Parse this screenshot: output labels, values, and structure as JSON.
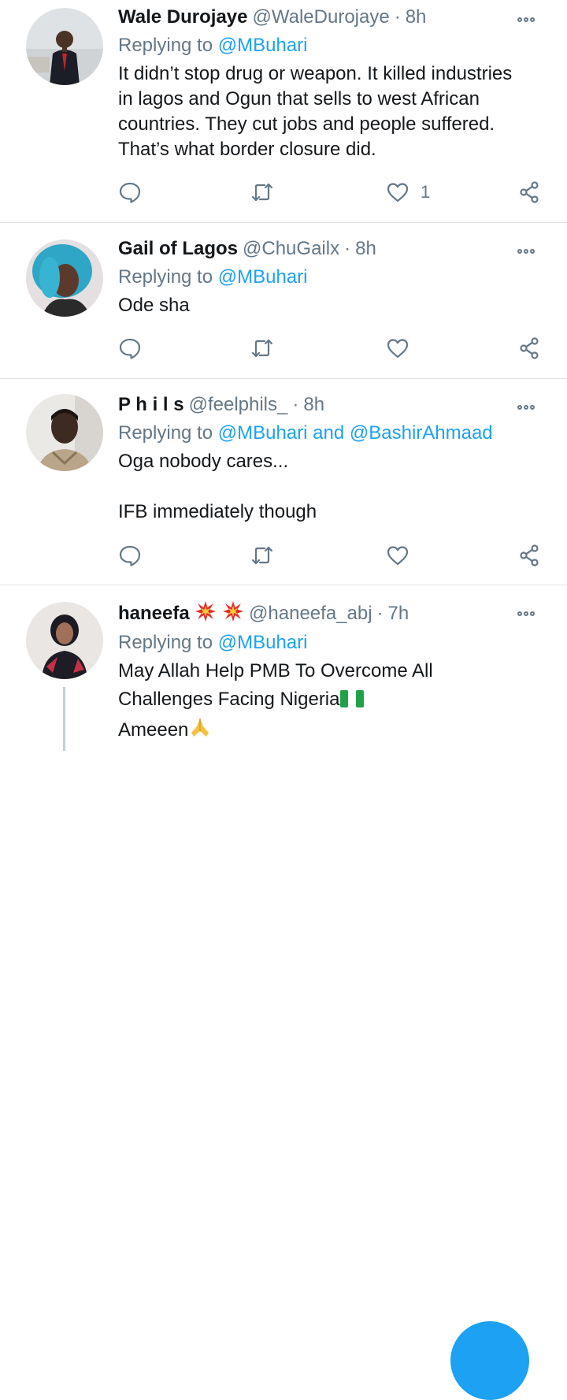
{
  "tweets": [
    {
      "name": "Wale Durojaye",
      "handle": "@WaleDurojaye",
      "separator": "·",
      "time": "8h",
      "replying_prefix": "Replying to",
      "mention1": "@MBuhari",
      "mention_joiner": "",
      "mention2": "",
      "body_lines": [
        "It didn’t stop drug or weapon. It killed industries",
        "in lagos and Ogun that sells to west African",
        "countries. They cut jobs and people suffered.",
        "That’s what border closure did."
      ],
      "like_count": "1"
    },
    {
      "name": "Gail of Lagos",
      "handle": "@ChuGailx",
      "separator": "·",
      "time": "8h",
      "replying_prefix": "Replying to",
      "mention1": "@MBuhari",
      "mention_joiner": "",
      "mention2": "",
      "body_lines": [
        "Ode sha"
      ],
      "like_count": ""
    },
    {
      "name": "P h i l s",
      "handle": "@feelphils_",
      "separator": "·",
      "time": "8h",
      "replying_prefix": "Replying to",
      "mention1": "@MBuhari",
      "mention_joiner": "and",
      "mention2": "@BashirAhmaad",
      "body_lines": [
        "Oga nobody cares...",
        "",
        "IFB immediately though"
      ],
      "like_count": ""
    },
    {
      "name": "haneefa",
      "handle": "@haneefa_abj",
      "separator": "·",
      "time": "7h",
      "replying_prefix": "Replying to",
      "mention1": "@MBuhari",
      "mention_joiner": "",
      "mention2": "",
      "body_lines": [
        "May Allah Help PMB To Overcome All",
        "Challenges Facing Nigeria",
        "Ameeen"
      ],
      "like_count": ""
    }
  ],
  "icons": {
    "reply": "comment-bubble-icon",
    "retweet": "retweet-icon",
    "like": "heart-icon",
    "share": "share-icon",
    "more": "more-options-icon",
    "emoji_spark": "collision-emoji-icon",
    "emoji_flag": "nigeria-flag-emoji-icon",
    "emoji_pray": "folded-hands-emoji-icon"
  },
  "colors": {
    "accent": "#1da1f2",
    "secondary_text": "#657786",
    "divider": "#dfe3e6",
    "icon": "#657786"
  }
}
